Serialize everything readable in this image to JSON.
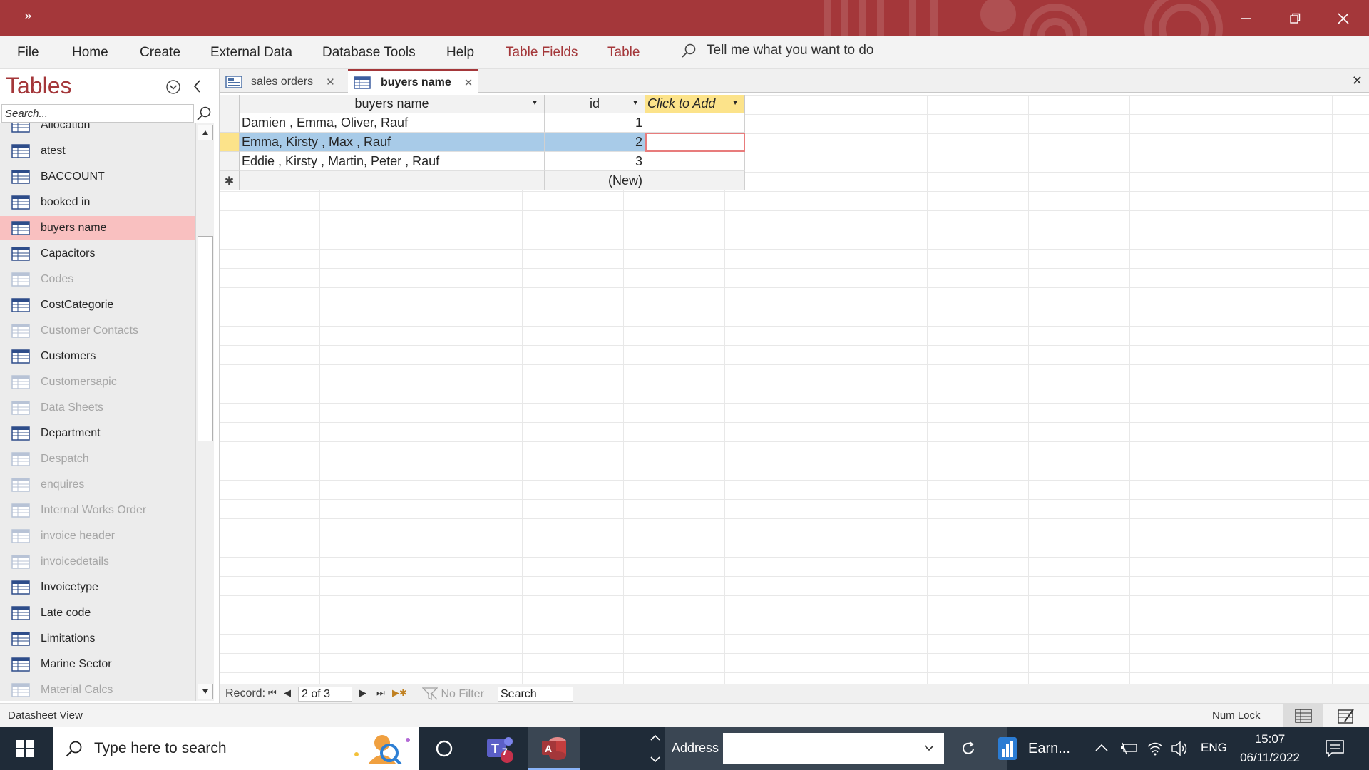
{
  "titlebar": {
    "quick_access": "»",
    "colors": {
      "brand": "#a4373a"
    }
  },
  "ribbon": {
    "tabs": [
      "File",
      "Home",
      "Create",
      "External Data",
      "Database Tools",
      "Help"
    ],
    "context_tabs": [
      "Table Fields",
      "Table"
    ],
    "tell_me": "Tell me what you want to do"
  },
  "nav": {
    "title": "Tables",
    "search_placeholder": "Search...",
    "items": [
      {
        "label": "Allocation",
        "dim": false
      },
      {
        "label": "atest",
        "dim": false
      },
      {
        "label": "BACCOUNT",
        "dim": false
      },
      {
        "label": "booked in",
        "dim": false
      },
      {
        "label": "buyers name",
        "dim": false,
        "selected": true
      },
      {
        "label": "Capacitors",
        "dim": false
      },
      {
        "label": "Codes",
        "dim": true
      },
      {
        "label": "CostCategorie",
        "dim": false
      },
      {
        "label": "Customer Contacts",
        "dim": true
      },
      {
        "label": "Customers",
        "dim": false
      },
      {
        "label": "Customersapic",
        "dim": true
      },
      {
        "label": "Data Sheets",
        "dim": true
      },
      {
        "label": "Department",
        "dim": false
      },
      {
        "label": "Despatch",
        "dim": true
      },
      {
        "label": "enquires",
        "dim": true
      },
      {
        "label": "Internal Works Order",
        "dim": true
      },
      {
        "label": "invoice header",
        "dim": true
      },
      {
        "label": "invoicedetails",
        "dim": true
      },
      {
        "label": "Invoicetype",
        "dim": false
      },
      {
        "label": "Late code",
        "dim": false
      },
      {
        "label": "Limitations",
        "dim": false
      },
      {
        "label": "Marine Sector",
        "dim": false
      },
      {
        "label": "Material Calcs",
        "dim": true
      }
    ]
  },
  "doc_tabs": [
    {
      "label": "sales orders",
      "active": false
    },
    {
      "label": "buyers name",
      "active": true
    }
  ],
  "table": {
    "columns": [
      "buyers name",
      "id",
      "Click to Add"
    ],
    "rows": [
      {
        "buyers_name": "Damien , Emma, Oliver, Rauf",
        "id": "1"
      },
      {
        "buyers_name": "Emma, Kirsty , Max , Rauf",
        "id": "2"
      },
      {
        "buyers_name": "Eddie , Kirsty , Martin, Peter , Rauf",
        "id": "3"
      }
    ],
    "new_row": "(New)",
    "new_row_marker": "✱"
  },
  "record_nav": {
    "label": "Record:",
    "position": "2 of 3",
    "filter": "No Filter",
    "search": "Search"
  },
  "status": {
    "view": "Datasheet View",
    "num_lock": "Num Lock"
  },
  "taskbar": {
    "search_placeholder": "Type here to search",
    "teams_badge": "7",
    "address_label": "Address",
    "app_label": "Earn...",
    "language": "ENG",
    "time": "15:07",
    "date": "06/11/2022"
  }
}
